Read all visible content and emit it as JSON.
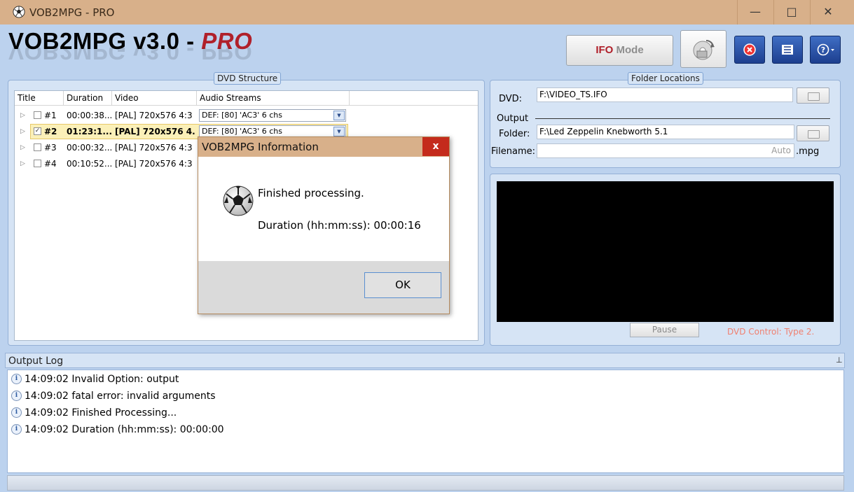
{
  "window": {
    "title": "VOB2MPG - PRO",
    "minimize": "—",
    "maximize": "□",
    "close": "✕"
  },
  "logo": {
    "main": "VOB2MPG v3.0 - ",
    "pro": "PRO"
  },
  "toolbar": {
    "ifo_prefix": "IFO",
    "ifo_suffix": " Mode",
    "icons": [
      "convert-disc-icon",
      "stop-icon",
      "list-icon",
      "help-icon"
    ]
  },
  "dvd_structure": {
    "title": "DVD Structure",
    "columns": [
      "Title",
      "Duration",
      "Video",
      "Audio Streams"
    ],
    "rows": [
      {
        "title": "#1",
        "duration": "00:00:38...",
        "video": "[PAL] 720x576 4:3",
        "audio": "DEF: [80]  'AC3' 6 chs",
        "checked": "",
        "selected": false
      },
      {
        "title": "#2",
        "duration": "01:23:1...",
        "video": "[PAL] 720x576 4...",
        "audio": "DEF: [80]  'AC3' 6 chs",
        "checked": "✓",
        "selected": true
      },
      {
        "title": "#3",
        "duration": "00:00:32...",
        "video": "[PAL] 720x576 4:3",
        "audio": "",
        "checked": "",
        "selected": false
      },
      {
        "title": "#4",
        "duration": "00:10:52...",
        "video": "[PAL] 720x576 4:3",
        "audio": "",
        "checked": "",
        "selected": false
      }
    ]
  },
  "folder_locations": {
    "title": "Folder Locations",
    "dvd_label": "DVD:",
    "dvd_value": "F:\\VIDEO_TS.IFO",
    "output_label": "Output",
    "folder_label": "Folder:",
    "folder_value": "F:\\Led Zeppelin Knebworth 5.1",
    "filename_label": "Filename:",
    "filename_placeholder": "Auto",
    "filename_ext": ".mpg"
  },
  "video": {
    "pause_label": "Pause",
    "dvd_control": "DVD Control: Type 2."
  },
  "output_log": {
    "title": "Output Log",
    "pin": "⊥",
    "lines": [
      "14:09:02  Invalid Option: output",
      "14:09:02  fatal error: invalid arguments",
      "14:09:02  Finished Processing...",
      "14:09:02  Duration (hh:mm:ss): 00:00:00"
    ]
  },
  "dialog": {
    "title": "VOB2MPG Information",
    "close": "x",
    "message": "Finished processing.",
    "duration": "Duration (hh:mm:ss): 00:00:16",
    "ok_label": "OK"
  },
  "colors": {
    "titlebar": "#d8b08a",
    "pro_red": "#b0202a",
    "panel_bg": "#d6e4f5",
    "highlight": "#fbf0b8",
    "dvd_control_text": "#f08070"
  }
}
